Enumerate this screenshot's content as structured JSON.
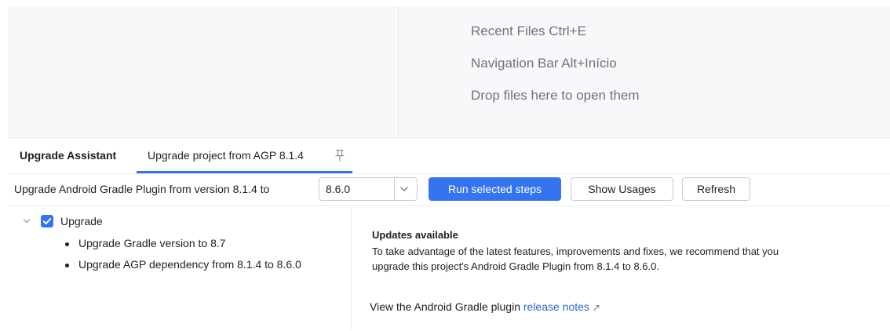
{
  "editor": {
    "hints": {
      "recent_files": "Recent Files Ctrl+E",
      "navigation_bar": "Navigation Bar Alt+Início",
      "drop_files": "Drop files here to open them"
    }
  },
  "tool_window": {
    "title": "Upgrade Assistant",
    "tab_label": "Upgrade project from AGP 8.1.4",
    "tab_icon": "pin-icon"
  },
  "toolbar": {
    "version_label": "Upgrade Android Gradle Plugin from version 8.1.4 to",
    "version_selected": "8.6.0",
    "run_button": "Run selected steps",
    "usages_button": "Show Usages",
    "refresh_button": "Refresh"
  },
  "tree": {
    "root_label": "Upgrade",
    "root_checked": true,
    "steps": [
      "Upgrade Gradle version to 8.7",
      "Upgrade AGP dependency from 8.1.4 to 8.6.0"
    ]
  },
  "details": {
    "heading": "Updates available",
    "body": "To take advantage of the latest features, improvements and fixes, we recommend that you upgrade this project's Android Gradle Plugin from 8.1.4 to 8.6.0.",
    "release_prefix": "View the Android Gradle plugin",
    "release_link": "release notes",
    "release_link_icon": "external-link-icon"
  },
  "colors": {
    "accent": "#3574f0",
    "link": "#2f65ca",
    "editor_background": "#f7f8fa",
    "hint_text": "#6f737a"
  }
}
